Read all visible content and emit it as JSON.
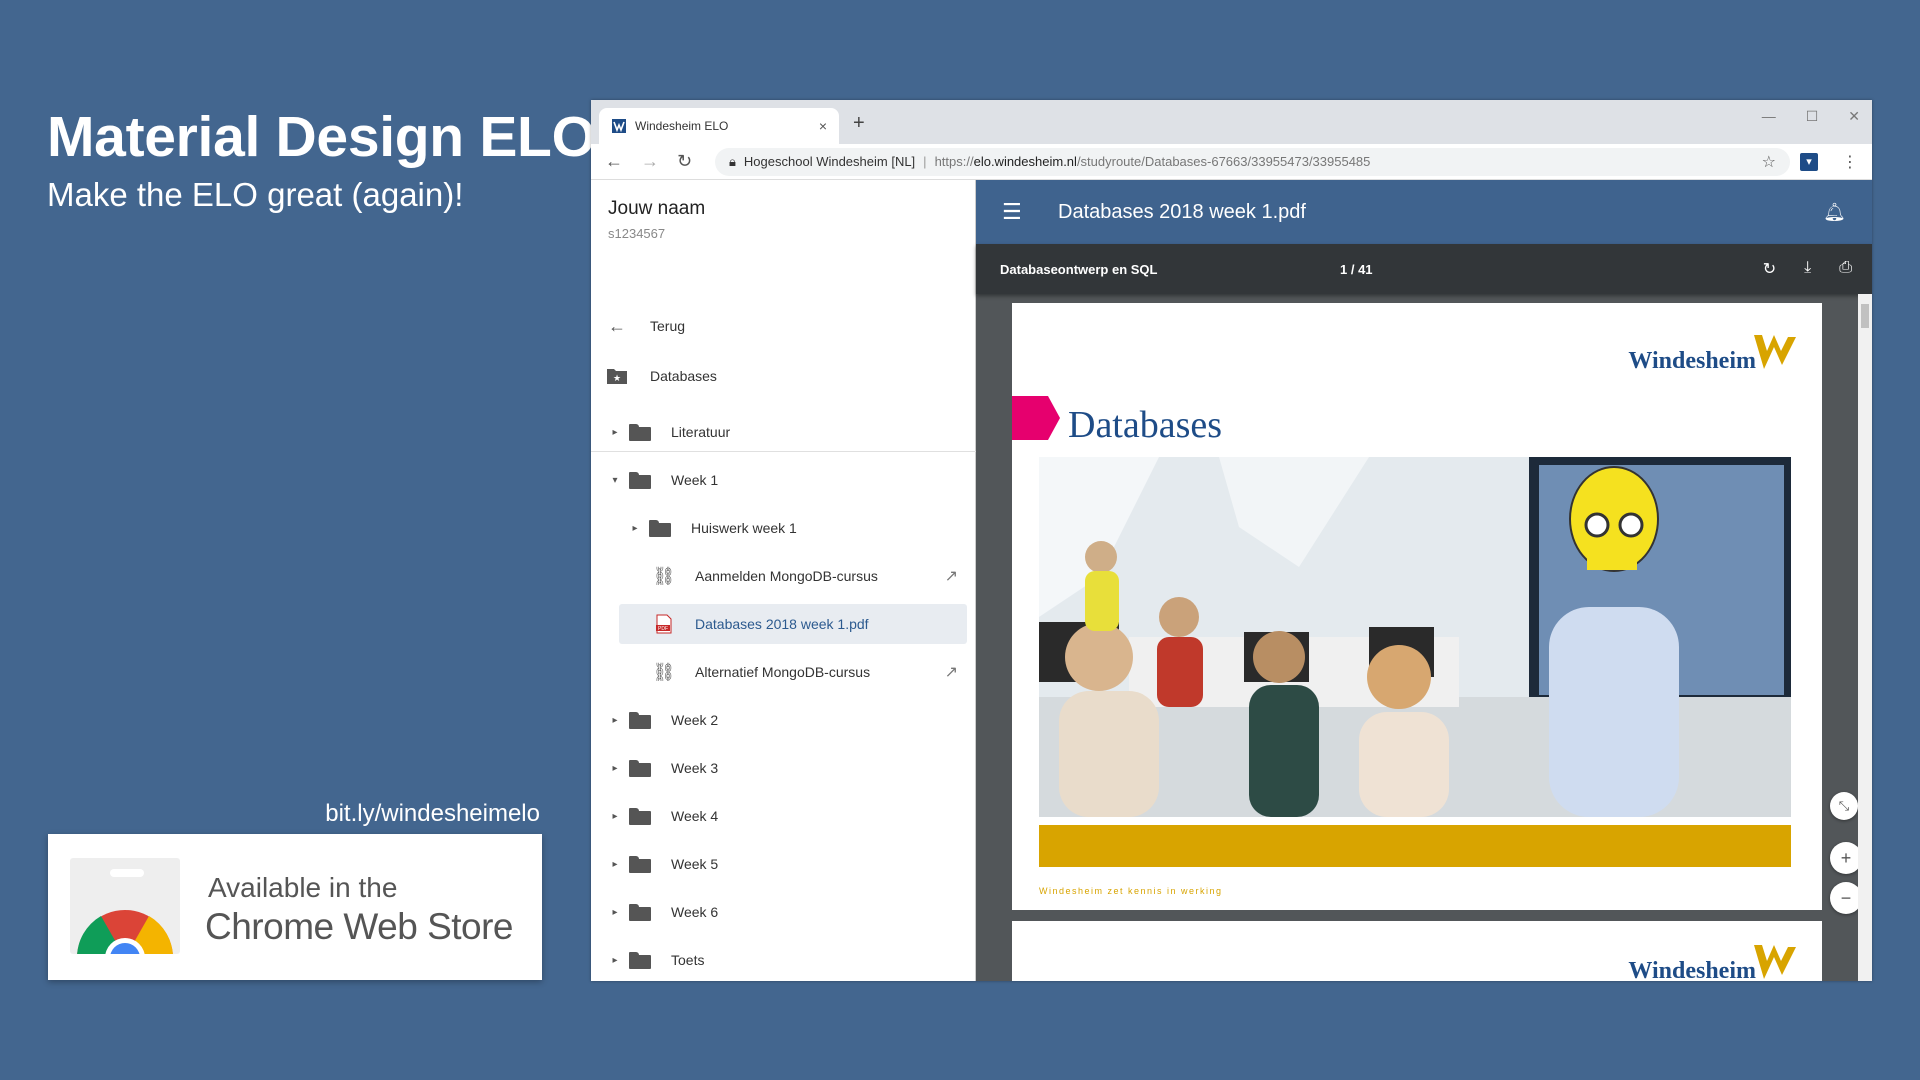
{
  "slide": {
    "title": "Material Design ELO",
    "subtitle": "Make the ELO great (again)!",
    "link": "bit.ly/windesheimelo",
    "badge_line1": "Available in the",
    "badge_line2": "Chrome Web Store"
  },
  "browser": {
    "tab_title": "Windesheim ELO",
    "tab_close": "×",
    "new_tab": "+",
    "site_name": "Hogeschool Windesheim [NL]",
    "url_prefix": "https://",
    "url_host": "elo.windesheim.nl",
    "url_path": "/studyroute/Databases-67663/33955473/33955485"
  },
  "sidebar": {
    "user_name": "Jouw naam",
    "user_id": "s1234567",
    "back_label": "Terug",
    "course_label": "Databases",
    "items": [
      {
        "label": "Literatuur",
        "kind": "folder",
        "expanded": false
      },
      {
        "label": "Week 1",
        "kind": "folder",
        "expanded": true
      },
      {
        "label": "Huiswerk week 1",
        "kind": "folder",
        "expanded": false
      },
      {
        "label": "Aanmelden MongoDB-cursus",
        "kind": "link"
      },
      {
        "label": "Databases 2018 week 1.pdf",
        "kind": "pdf",
        "selected": true
      },
      {
        "label": "Alternatief MongoDB-cursus",
        "kind": "link"
      },
      {
        "label": "Week 2",
        "kind": "folder",
        "expanded": false
      },
      {
        "label": "Week 3",
        "kind": "folder",
        "expanded": false
      },
      {
        "label": "Week 4",
        "kind": "folder",
        "expanded": false
      },
      {
        "label": "Week 5",
        "kind": "folder",
        "expanded": false
      },
      {
        "label": "Week 6",
        "kind": "folder",
        "expanded": false
      },
      {
        "label": "Toets",
        "kind": "folder",
        "expanded": false
      }
    ]
  },
  "viewer": {
    "title": "Databases 2018 week 1.pdf",
    "doc_title": "Databaseontwerp en SQL",
    "page_indicator": "1 / 41",
    "slide_logo": "Windesheim",
    "slide_heading": "Databases",
    "slide_footer": "Windesheim zet kennis in werking"
  },
  "colors": {
    "background": "#43668f",
    "appbar": "#3f638e",
    "accent_gold": "#d8a400",
    "accent_pink": "#e6006e",
    "brand_blue": "#1e4c87"
  }
}
